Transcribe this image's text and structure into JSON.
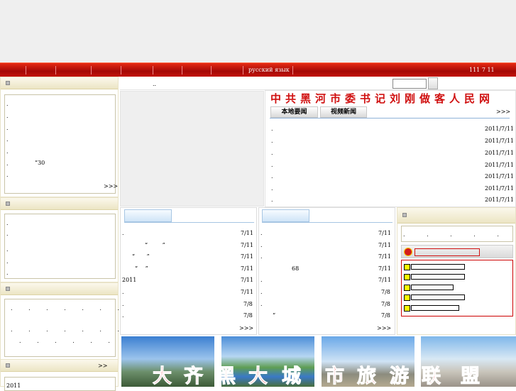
{
  "nav": {
    "russian": "русский язык",
    "date": "111 7 11"
  },
  "marquee": "..",
  "site_title": "中共黑河市委书记刘刚做客人民网",
  "tabs": [
    "本地要闻",
    "视频新闻"
  ],
  "more": ">>>",
  "left1": {
    "items": [
      ".",
      ".",
      ".",
      ".",
      ".",
      ".",
      "“30",
      "."
    ],
    "more": ">>>"
  },
  "left2": {
    "items": [
      ".",
      ".",
      ".",
      ".",
      "."
    ]
  },
  "left3": {
    "rows": [
      ". . . . . . .",
      ". . . . . . .",
      ". . . . . ."
    ]
  },
  "left4": {
    "more": ">>",
    "item": "2011"
  },
  "news": {
    "items": [
      ".",
      ".",
      ".",
      ".",
      ".",
      ".",
      "."
    ],
    "dates": [
      "2011/7/11",
      "2011/7/11",
      "2011/7/11",
      "2011/7/11",
      "2011/7/11",
      "2011/7/11",
      "2011/7/11"
    ]
  },
  "col1": {
    "items": [
      ".",
      "“ ”",
      "“ ”",
      "“ ”",
      "2011",
      ".",
      ".",
      "."
    ],
    "dates": [
      "7/11",
      "7/11",
      "7/11",
      "7/11",
      "7/11",
      "7/11",
      "7/8",
      "7/8"
    ],
    "more": ">>>"
  },
  "col2": {
    "items": [
      ".",
      ".",
      ".",
      "68",
      ".",
      ".",
      ".",
      "“"
    ],
    "dates": [
      "7/11",
      "7/11",
      "7/11",
      "7/11",
      "7/11",
      "7/8",
      "7/8",
      "7/8"
    ],
    "more": ">>>"
  },
  "right_small": ". . . . . .",
  "warning": {
    "title": "",
    "rows": [
      "",
      "",
      "",
      "",
      ""
    ]
  },
  "banner": [
    "大",
    "齐",
    "黑",
    "大",
    "城",
    "市",
    "旅",
    "游",
    "联",
    "盟"
  ],
  "colors": {
    "nav_red": "#c31309",
    "banner_red": "#e31b1b",
    "title_red": "#d01010"
  }
}
